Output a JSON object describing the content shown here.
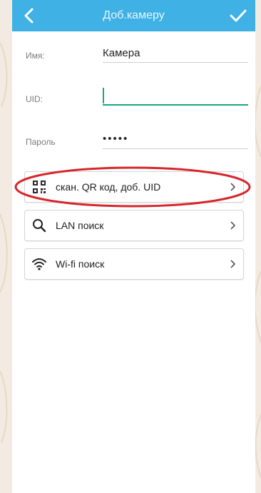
{
  "header": {
    "title": "Доб.камеру",
    "back_icon": "chevron-left-icon",
    "confirm_icon": "checkmark-icon"
  },
  "form": {
    "name_label": "Имя:",
    "name_value": "Камера",
    "uid_label": "UID:",
    "uid_value": "",
    "password_label": "Пароль",
    "password_value": "•••••"
  },
  "options": [
    {
      "label": "скан. QR код, доб. UID",
      "icon": "qr-code-icon"
    },
    {
      "label": "LAN поиск",
      "icon": "search-icon"
    },
    {
      "label": "Wi-fi поиск",
      "icon": "wifi-icon"
    }
  ],
  "colors": {
    "header_bg": "#3fb1e5",
    "active_field": "#1aa58a",
    "highlight_ellipse": "#d7262c",
    "outer_background": "#f3ebe1"
  }
}
